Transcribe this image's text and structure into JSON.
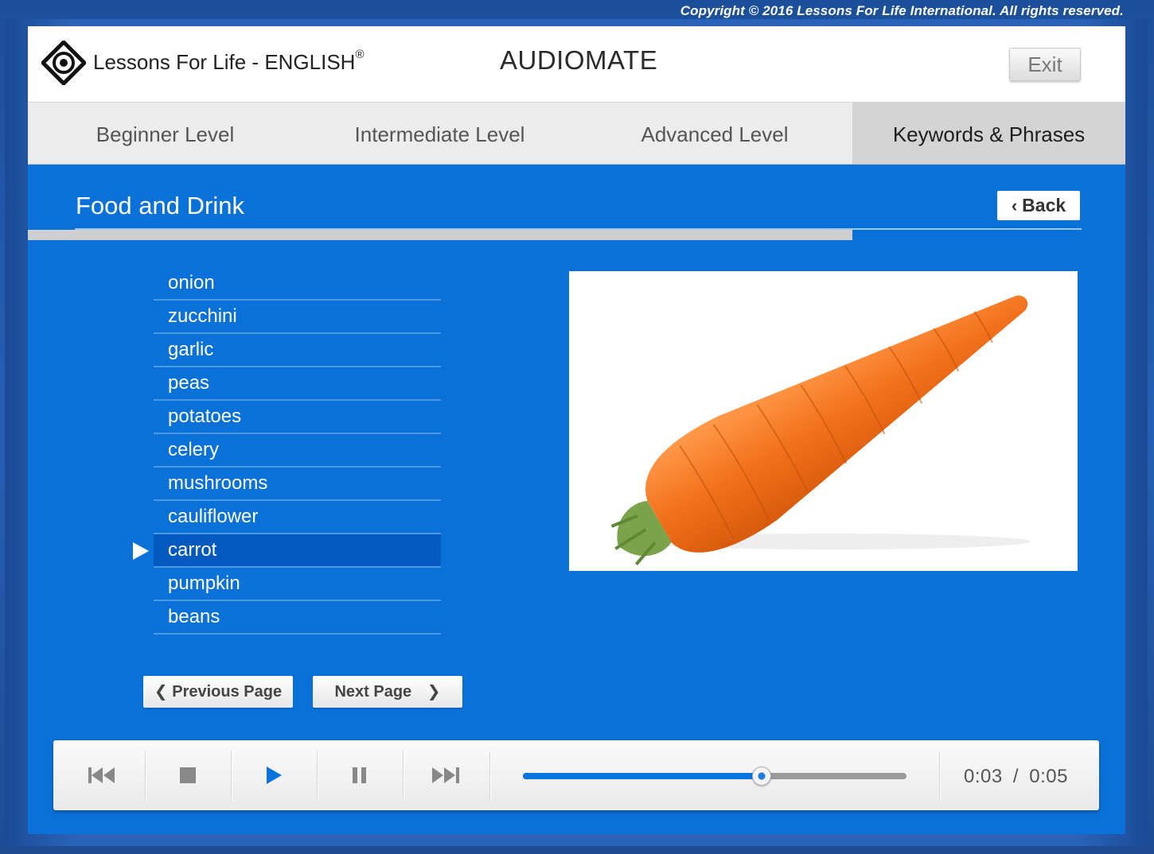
{
  "copyright": "Copyright © 2016 Lessons For Life International. All rights reserved.",
  "header": {
    "logo_text": "Lessons For Life - ENGLISH",
    "logo_mark": "®",
    "app_title": "AUDIOMATE",
    "exit_label": "Exit"
  },
  "tabs": [
    {
      "label": "Beginner Level",
      "active": false
    },
    {
      "label": "Intermediate Level",
      "active": false
    },
    {
      "label": "Advanced Level",
      "active": false
    },
    {
      "label": "Keywords & Phrases",
      "active": true
    }
  ],
  "section": {
    "title": "Food and Drink",
    "back_label": "Back"
  },
  "words": [
    "onion",
    "zucchini",
    "garlic",
    "peas",
    "potatoes",
    "celery",
    "mushrooms",
    "cauliflower",
    "carrot",
    "pumpkin",
    "beans"
  ],
  "selected_word": "carrot",
  "pagination": {
    "previous_label": "Previous Page",
    "next_label": "Next Page"
  },
  "player": {
    "current_time": "0:03",
    "separator": "/",
    "total_time": "0:05",
    "progress_fraction": 0.62,
    "accent_color": "#0a74de"
  },
  "colors": {
    "app_background": "#0a71d8",
    "selected_row": "#0359bd",
    "carrot": "#f3711c"
  }
}
